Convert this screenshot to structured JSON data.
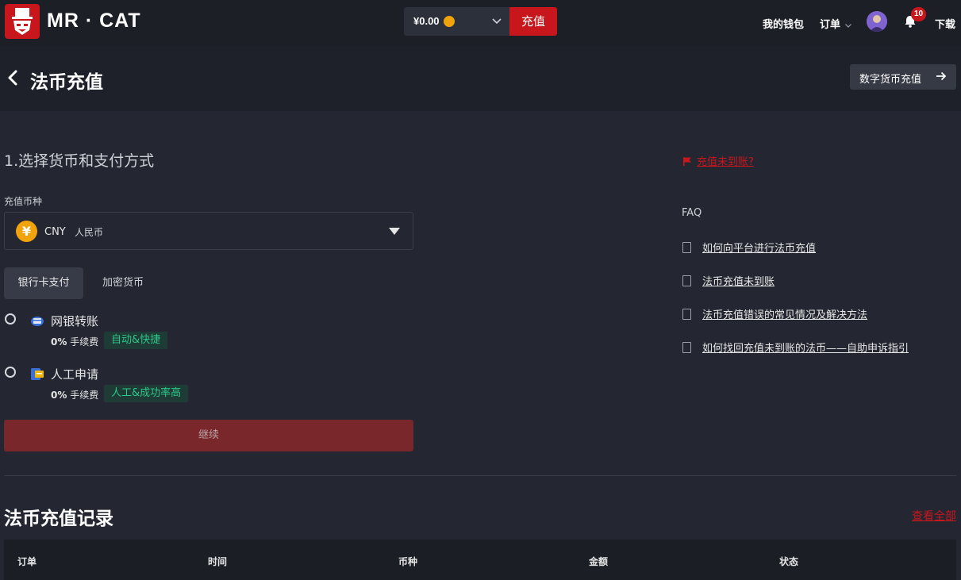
{
  "header": {
    "brand": "MR · CAT",
    "balance": "¥0.00",
    "topup_label": "充值",
    "wallet_label": "我的钱包",
    "orders_label": "订单",
    "notification_count": "10",
    "download_label": "下载"
  },
  "page": {
    "title": "法币充值",
    "crypto_topup_label": "数字货币充值"
  },
  "form": {
    "section_title": "1.选择货币和支付方式",
    "currency_label": "充值币种",
    "currency_code": "CNY",
    "currency_name": "人民币",
    "tabs": [
      {
        "label": "银行卡支付",
        "active": true
      },
      {
        "label": "加密货币",
        "active": false
      }
    ],
    "methods": [
      {
        "name": "网银转账",
        "fee_value": "0%",
        "fee_label": "手续费",
        "tag": "自动&快捷"
      },
      {
        "name": "人工申请",
        "fee_value": "0%",
        "fee_label": "手续费",
        "tag": "人工&成功率高"
      }
    ],
    "continue_label": "继续"
  },
  "help": {
    "not_arrived_link": "充值未到账?",
    "faq_title": "FAQ",
    "faq_items": [
      "如何向平台进行法币充值",
      "法币充值未到账",
      "法币充值错误的常见情况及解决方法",
      "如何找回充值未到账的法币——自助申诉指引"
    ]
  },
  "records": {
    "title": "法币充值记录",
    "view_all": "查看全部",
    "columns": [
      "订单",
      "时间",
      "币种",
      "金额",
      "状态"
    ]
  },
  "colors": {
    "brand_red": "#c8161d",
    "tag_green": "#2ec78a",
    "coin_gold": "#f0a30a"
  }
}
